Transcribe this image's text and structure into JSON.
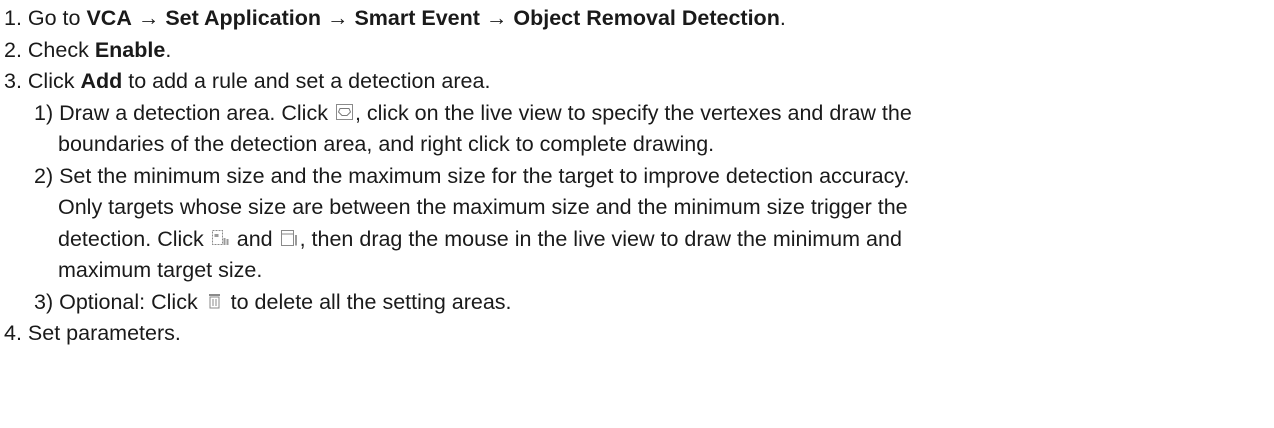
{
  "steps": {
    "s1": {
      "prefix": "1. Go to ",
      "vca": "VCA",
      "arrow1": " → ",
      "set_app": "Set Application",
      "arrow2": " → ",
      "smart": "Smart Event",
      "arrow3": " → ",
      "ord": "Object Removal Detection",
      "suffix": "."
    },
    "s2": {
      "prefix": "2. Check ",
      "enable": "Enable",
      "suffix": "."
    },
    "s3": {
      "prefix": "3. Click ",
      "add": "Add",
      "suffix": " to add a rule and set a detection area."
    },
    "s3_1": {
      "text_a": "1) Draw a detection area. Click ",
      "text_b": ", click on the live view to specify the vertexes and draw the",
      "text_c": "boundaries of the detection area, and right click to complete drawing."
    },
    "s3_2": {
      "text_a": "2) Set the minimum size and the maximum size for the target to improve detection accuracy.",
      "text_b": "Only targets whose size are between the maximum size and the minimum size trigger the",
      "text_c": "detection. Click ",
      "text_d": " and ",
      "text_e": ", then drag the mouse in the live view to draw the minimum and",
      "text_f": "maximum target size."
    },
    "s3_3": {
      "text_a": "3) Optional: Click ",
      "text_b": " to delete all the setting areas."
    },
    "s4": {
      "text": "4. Set parameters."
    }
  },
  "icons": {
    "draw_area": "polygon-draw-icon",
    "min_size": "min-target-size-icon",
    "max_size": "max-target-size-icon",
    "delete_all": "trash-icon"
  }
}
